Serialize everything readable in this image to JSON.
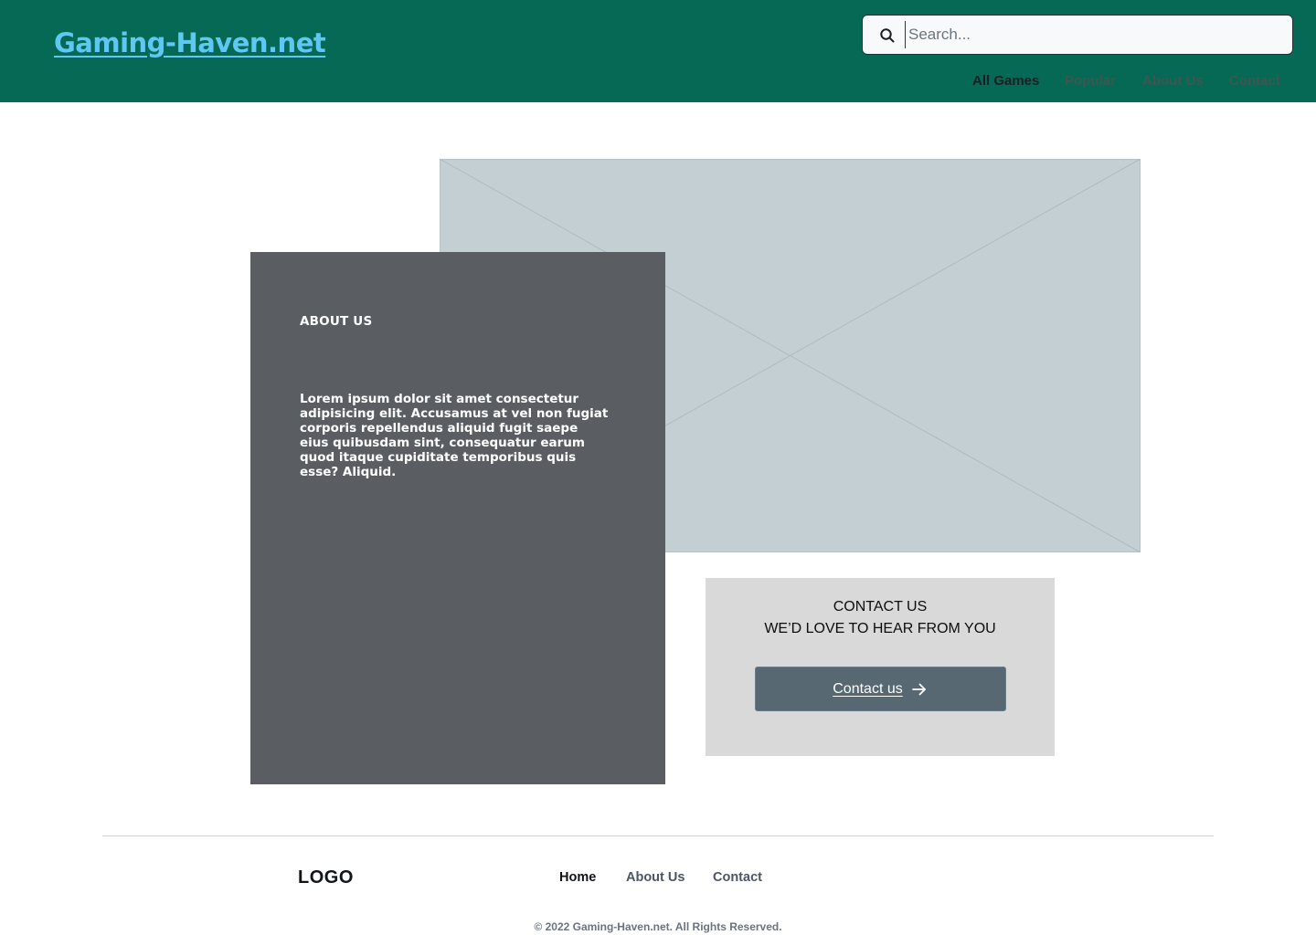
{
  "header": {
    "brand": "Gaming-Haven.net",
    "search": {
      "placeholder": "Search...",
      "value": ""
    },
    "nav": [
      {
        "label": "All Games",
        "active": true
      },
      {
        "label": "Popular",
        "active": false
      },
      {
        "label": "About Us",
        "active": false
      },
      {
        "label": "Contact",
        "active": false
      }
    ]
  },
  "about": {
    "title": "ABOUT US",
    "text": "Lorem ipsum dolor sit amet consectetur adipisicing elit. Accusamus at vel non fugiat corporis repellendus aliquid fugit saepe eius quibusdam sint, consequatur earum quod itaque cupiditate temporibus quis esse? Aliquid."
  },
  "contact": {
    "title": "CONTACT US",
    "subtitle": "WE’D LOVE TO HEAR FROM YOU",
    "button_label": "Contact us"
  },
  "footer": {
    "logo": "LOGO",
    "nav": [
      {
        "label": "Home",
        "active": true
      },
      {
        "label": "About Us",
        "active": false
      },
      {
        "label": "Contact",
        "active": false
      }
    ],
    "copyright": "© 2022 Gaming-Haven.net. All Rights Reserved."
  },
  "colors": {
    "header_bg": "#066956",
    "brand": "#5fc8f2",
    "about_bg": "#5a5d62",
    "hero_placeholder": "#c4cfd4",
    "contact_bg": "#d9d9d9",
    "contact_button": "#576872"
  },
  "icons": {
    "search": "search-icon",
    "arrow": "arrow-right-icon"
  }
}
